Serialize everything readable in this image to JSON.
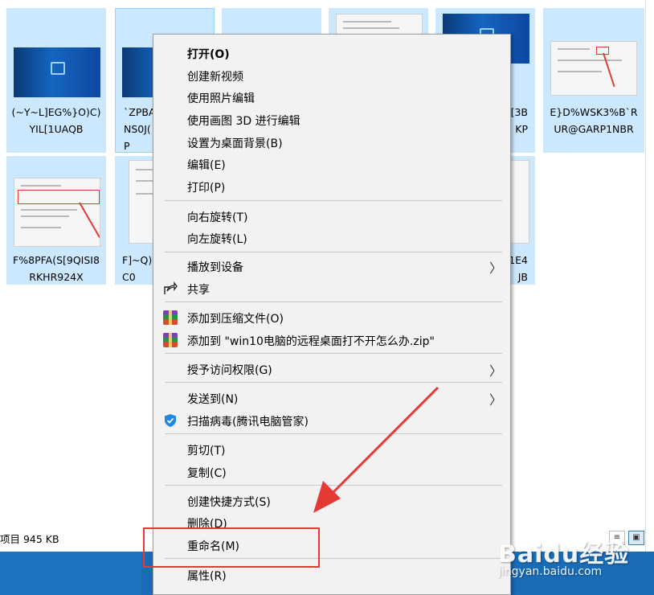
{
  "files": [
    {
      "name": "(~Y~L]EG%}O)C)YIL[1UAQB",
      "thumb": "blue"
    },
    {
      "name": "`ZPBA\nNS0J(\nP",
      "thumb": "blue"
    },
    {
      "name": "",
      "thumb": "doc"
    },
    {
      "name": "",
      "thumb": "doc"
    },
    {
      "name": "[3B\nKP",
      "thumb": "blue"
    },
    {
      "name": "E}D%WSK3%B`RUR@GARP1NBR",
      "thumb": "doc"
    },
    {
      "name": "F%8PFA(S[9QISI8RKHR924X",
      "thumb": "doc"
    },
    {
      "name": "F]~Q)\nC0",
      "thumb": "doc"
    },
    {
      "name": "1E4\nJB",
      "thumb": "doc"
    }
  ],
  "status": {
    "text": "项目   945 KB"
  },
  "view_icons": [
    "details-view",
    "large-icons-view"
  ],
  "context_menu": {
    "items": [
      {
        "label": "打开(O)",
        "bold": true
      },
      {
        "label": "创建新视频"
      },
      {
        "label": "使用照片编辑"
      },
      {
        "label": "使用画图 3D 进行编辑"
      },
      {
        "label": "设置为桌面背景(B)"
      },
      {
        "label": "编辑(E)"
      },
      {
        "label": "打印(P)"
      },
      {
        "label": "向右旋转(T)"
      },
      {
        "label": "向左旋转(L)"
      },
      {
        "label": "播放到设备",
        "submenu": true
      },
      {
        "label": "共享",
        "icon": "share-icon"
      },
      {
        "label": "添加到压缩文件(O)",
        "icon": "winrar-icon"
      },
      {
        "label": "添加到 \"win10电脑的远程桌面打不开怎么办.zip\"",
        "icon": "winrar-icon"
      },
      {
        "label": "授予访问权限(G)",
        "submenu": true
      },
      {
        "label": "发送到(N)",
        "submenu": true
      },
      {
        "label": "扫描病毒(腾讯电脑管家)",
        "icon": "shield-icon"
      },
      {
        "label": "剪切(T)"
      },
      {
        "label": "复制(C)"
      },
      {
        "label": "创建快捷方式(S)"
      },
      {
        "label": "删除(D)"
      },
      {
        "label": "重命名(M)"
      },
      {
        "label": "属性(R)"
      }
    ]
  },
  "annotation": {
    "highlighted_item": "重命名(M)",
    "color": "#e53935"
  },
  "watermark": {
    "brand": "Baidu经验",
    "url": "jingyan.baidu.com"
  },
  "colors": {
    "selection": "#cce8ff",
    "menu_bg": "#f2f2f2",
    "taskbar": "#1a6cb6"
  }
}
